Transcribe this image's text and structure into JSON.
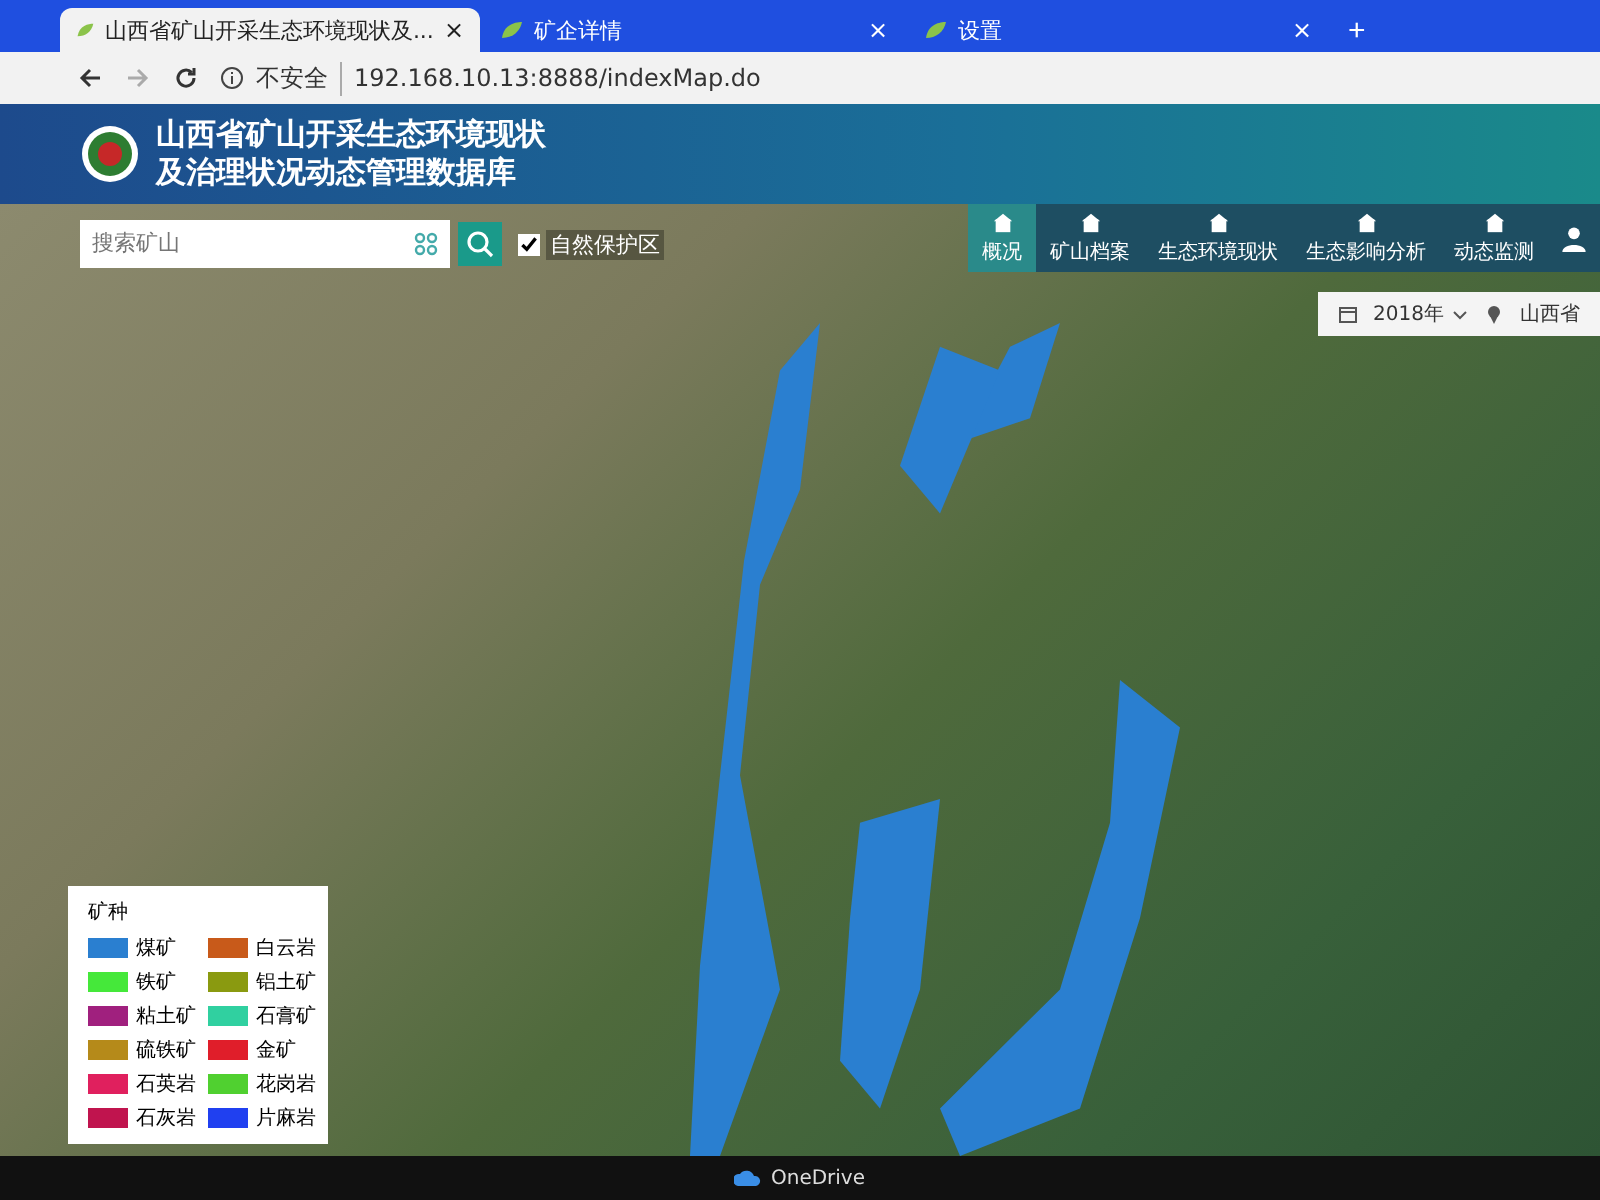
{
  "browser": {
    "tabs": [
      {
        "label": "山西省矿山开采生态环境现状及...",
        "selected": true,
        "close": "×"
      },
      {
        "label": "矿企详情",
        "selected": false,
        "close": "×"
      },
      {
        "label": "设置",
        "selected": false,
        "close": "×"
      }
    ],
    "new_tab": "+",
    "security": "不安全",
    "url": "192.168.10.13:8888/indexMap.do"
  },
  "header": {
    "title_lines": [
      "山西省矿山开采生态环境现状",
      "及治理状况动态管理数据库"
    ]
  },
  "search": {
    "placeholder": "搜索矿山"
  },
  "layer_toggle": {
    "label": "自然保护区",
    "checked": true
  },
  "nav": [
    {
      "label": "概况",
      "selected": true
    },
    {
      "label": "矿山档案",
      "selected": false
    },
    {
      "label": "生态环境现状",
      "selected": false
    },
    {
      "label": "生态影响分析",
      "selected": false
    },
    {
      "label": "动态监测",
      "selected": false
    }
  ],
  "toolbar": {
    "year": "2018年",
    "region": "山西省"
  },
  "legend": {
    "title": "矿种",
    "items": [
      {
        "label": "煤矿",
        "color": "#2a7fd0"
      },
      {
        "label": "白云岩",
        "color": "#c85a1a"
      },
      {
        "label": "铁矿",
        "color": "#45e83a"
      },
      {
        "label": "铝土矿",
        "color": "#8a9a10"
      },
      {
        "label": "粘土矿",
        "color": "#a0207e"
      },
      {
        "label": "石膏矿",
        "color": "#30d0a0"
      },
      {
        "label": "硫铁矿",
        "color": "#b58a1a"
      },
      {
        "label": "金矿",
        "color": "#e01e2a"
      },
      {
        "label": "石英岩",
        "color": "#e0205e"
      },
      {
        "label": "花岗岩",
        "color": "#50d030"
      },
      {
        "label": "石灰岩",
        "color": "#c0144e"
      },
      {
        "label": "片麻岩",
        "color": "#2040f0"
      }
    ]
  },
  "taskbar": {
    "apps": [
      "OneDrive"
    ]
  }
}
